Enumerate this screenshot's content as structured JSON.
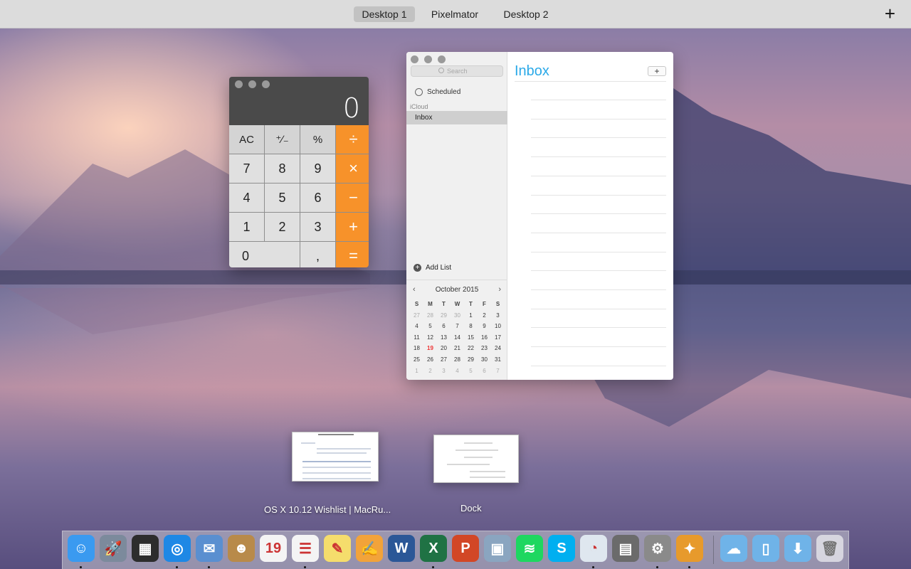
{
  "spaces_bar": {
    "tabs": [
      {
        "label": "Desktop 1",
        "active": true
      },
      {
        "label": "Pixelmator",
        "active": false
      },
      {
        "label": "Desktop 2",
        "active": false
      }
    ],
    "add_label": "+"
  },
  "calculator": {
    "display": "0",
    "keys": [
      {
        "label": "AC",
        "kind": "top"
      },
      {
        "label": "⁺∕₋",
        "kind": "top"
      },
      {
        "label": "%",
        "kind": "top"
      },
      {
        "label": "÷",
        "kind": "op"
      },
      {
        "label": "7",
        "kind": "num"
      },
      {
        "label": "8",
        "kind": "num"
      },
      {
        "label": "9",
        "kind": "num"
      },
      {
        "label": "×",
        "kind": "op"
      },
      {
        "label": "4",
        "kind": "num"
      },
      {
        "label": "5",
        "kind": "num"
      },
      {
        "label": "6",
        "kind": "num"
      },
      {
        "label": "−",
        "kind": "op"
      },
      {
        "label": "1",
        "kind": "num"
      },
      {
        "label": "2",
        "kind": "num"
      },
      {
        "label": "3",
        "kind": "num"
      },
      {
        "label": "+",
        "kind": "op"
      },
      {
        "label": "0",
        "kind": "zero"
      },
      {
        "label": ",",
        "kind": "num"
      },
      {
        "label": "=",
        "kind": "op"
      }
    ]
  },
  "reminders": {
    "search_placeholder": "Search",
    "scheduled_label": "Scheduled",
    "account_label": "iCloud",
    "inbox_item": "Inbox",
    "add_list_label": "Add List",
    "title": "Inbox",
    "add_button": "+",
    "calendar": {
      "month_label": "October 2015",
      "weekdays": [
        "S",
        "M",
        "T",
        "W",
        "T",
        "F",
        "S"
      ],
      "weeks": [
        [
          "27",
          "28",
          "29",
          "30",
          "1",
          "2",
          "3"
        ],
        [
          "4",
          "5",
          "6",
          "7",
          "8",
          "9",
          "10"
        ],
        [
          "11",
          "12",
          "13",
          "14",
          "15",
          "16",
          "17"
        ],
        [
          "18",
          "19",
          "20",
          "21",
          "22",
          "23",
          "24"
        ],
        [
          "25",
          "26",
          "27",
          "28",
          "29",
          "30",
          "31"
        ],
        [
          "1",
          "2",
          "3",
          "4",
          "5",
          "6",
          "7"
        ]
      ],
      "today": "19",
      "highlight_color": "#e33333"
    },
    "accent_color": "#2aa9e8"
  },
  "thumbnails": [
    {
      "label": "OS X 10.12 Wishlist | MacRu..."
    },
    {
      "label": "Dock"
    }
  ],
  "dock": {
    "apps": [
      {
        "icon": "finder-icon",
        "glyph": "☺",
        "color": "#3a9af0",
        "running": true
      },
      {
        "icon": "launchpad-icon",
        "glyph": "🚀",
        "color": "#7c8a9c",
        "running": false
      },
      {
        "icon": "mission-control-icon",
        "glyph": "▦",
        "color": "#2d2d2d",
        "running": false
      },
      {
        "icon": "safari-icon",
        "glyph": "◎",
        "color": "#1e88e5",
        "running": true
      },
      {
        "icon": "mail-icon",
        "glyph": "✉",
        "color": "#5a8fd0",
        "running": true
      },
      {
        "icon": "contacts-icon",
        "glyph": "☻",
        "color": "#b88a4a",
        "running": false
      },
      {
        "icon": "calendar-icon",
        "glyph": "19",
        "color": "#f4f4f4",
        "running": false
      },
      {
        "icon": "reminders-icon",
        "glyph": "☰",
        "color": "#f4f4f4",
        "running": true
      },
      {
        "icon": "notes-icon",
        "glyph": "✎",
        "color": "#f5dd6c",
        "running": false
      },
      {
        "icon": "pages-icon",
        "glyph": "✍",
        "color": "#f2a33a",
        "running": false
      },
      {
        "icon": "word-icon",
        "glyph": "W",
        "color": "#2b5797",
        "running": false
      },
      {
        "icon": "excel-icon",
        "glyph": "X",
        "color": "#1f7244",
        "running": true
      },
      {
        "icon": "powerpoint-icon",
        "glyph": "P",
        "color": "#d24726",
        "running": false
      },
      {
        "icon": "preview-icon",
        "glyph": "▣",
        "color": "#8aa5c0",
        "running": false
      },
      {
        "icon": "spotify-icon",
        "glyph": "≋",
        "color": "#1ed760",
        "running": false
      },
      {
        "icon": "skype-icon",
        "glyph": "S",
        "color": "#00aff0",
        "running": false
      },
      {
        "icon": "app-store-icon",
        "glyph": "◔",
        "color": "#dfe7ef",
        "running": true
      },
      {
        "icon": "calculator-icon",
        "glyph": "▤",
        "color": "#6b6b6b",
        "running": false
      },
      {
        "icon": "system-preferences-icon",
        "glyph": "⚙",
        "color": "#8a8a8a",
        "running": true
      },
      {
        "icon": "pixelmator-icon",
        "glyph": "✦",
        "color": "#e79a2c",
        "running": true
      }
    ],
    "folders": [
      {
        "icon": "icloud-drive-folder-icon",
        "glyph": "☁"
      },
      {
        "icon": "documents-folder-icon",
        "glyph": "▯"
      },
      {
        "icon": "downloads-folder-icon",
        "glyph": "⬇"
      },
      {
        "icon": "trash-icon",
        "glyph": "🗑"
      }
    ]
  }
}
